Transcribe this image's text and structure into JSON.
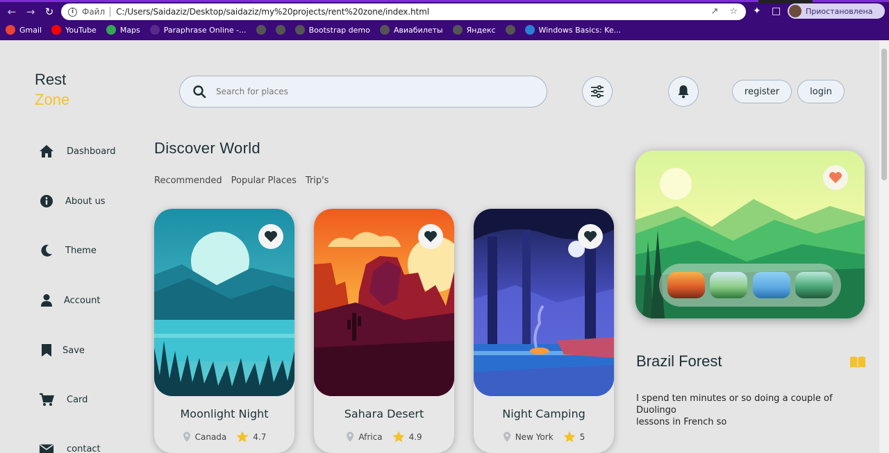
{
  "browser": {
    "file_label": "Файл",
    "url": "C:/Users/Saidaziz/Desktop/saidaziz/my%20projects/rent%20zone/index.html",
    "profile_status": "Приостановлена",
    "bookmarks": [
      {
        "label": "Gmail",
        "color": "#ea4335"
      },
      {
        "label": "YouTube",
        "color": "#ff0000"
      },
      {
        "label": "Maps",
        "color": "#34a853"
      },
      {
        "label": "Paraphrase Online -...",
        "color": "#5a2a8a"
      },
      {
        "label": "",
        "color": "#555"
      },
      {
        "label": "",
        "color": "#555"
      },
      {
        "label": "Bootstrap demo",
        "color": "#555"
      },
      {
        "label": "Авиабилеты",
        "color": "#555"
      },
      {
        "label": "Яндекс",
        "color": "#555"
      },
      {
        "label": "",
        "color": "#555"
      },
      {
        "label": "Windows Basics: Ke...",
        "color": "#2a7fd4"
      }
    ]
  },
  "logo": {
    "line1": "Rest",
    "line2": "Zone"
  },
  "search": {
    "placeholder": "Search for places"
  },
  "header": {
    "register": "register",
    "login": "login"
  },
  "sidebar": {
    "items": [
      {
        "label": "Dashboard",
        "icon": "home-icon"
      },
      {
        "label": "About us",
        "icon": "info-icon"
      },
      {
        "label": "Theme",
        "icon": "moon-icon"
      },
      {
        "label": "Account",
        "icon": "user-icon"
      },
      {
        "label": "Save",
        "icon": "bookmark-icon"
      },
      {
        "label": "Card",
        "icon": "cart-icon"
      },
      {
        "label": "contact",
        "icon": "mail-icon"
      }
    ]
  },
  "main": {
    "title": "Discover World",
    "tabs": [
      "Recommended",
      "Popular Places",
      "Trip's"
    ],
    "cards": [
      {
        "name": "Moonlight Night",
        "location": "Canada",
        "rating": "4.7"
      },
      {
        "name": "Sahara Desert",
        "location": "Africa",
        "rating": "4.9"
      },
      {
        "name": "Night Camping",
        "location": "New York",
        "rating": "5"
      }
    ]
  },
  "detail": {
    "title": "Brazil Forest",
    "text_line1": "I spend ten minutes or so doing a couple of",
    "text_line2": "Duolingo",
    "text_line3": "lessons in French so"
  },
  "colors": {
    "accent_yellow": "#f3c22b",
    "dark_text": "#1d3035",
    "heart_orange": "#f07a55",
    "star": "#f3c22b",
    "chrome": "#3a0a78"
  }
}
